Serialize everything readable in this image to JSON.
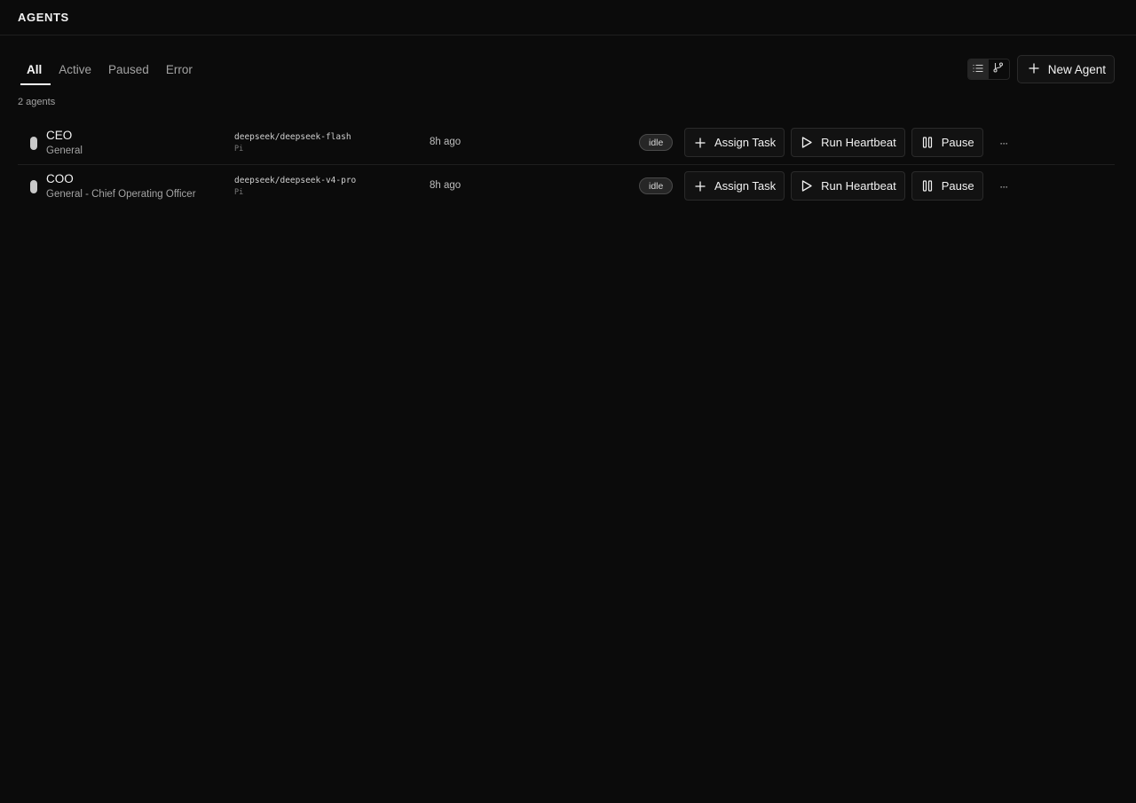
{
  "header": {
    "title": "AGENTS"
  },
  "tabs": [
    {
      "label": "All",
      "active": true
    },
    {
      "label": "Active",
      "active": false
    },
    {
      "label": "Paused",
      "active": false
    },
    {
      "label": "Error",
      "active": false
    }
  ],
  "toolbar": {
    "view_modes": [
      "list-icon",
      "tree-icon"
    ],
    "selected_view": "list",
    "new_agent_label": "New Agent"
  },
  "count_label": "2 agents",
  "agents": [
    {
      "name": "CEO",
      "role": "General",
      "model": "deepseek/deepseek-flash",
      "provider": "Pi",
      "last_active": "8h ago",
      "status": "idle",
      "actions": {
        "assign": "Assign Task",
        "heartbeat": "Run Heartbeat",
        "pause": "Pause",
        "more": "···"
      }
    },
    {
      "name": "COO",
      "role": "General - Chief Operating Officer",
      "model": "deepseek/deepseek-v4-pro",
      "provider": "Pi",
      "last_active": "8h ago",
      "status": "idle",
      "actions": {
        "assign": "Assign Task",
        "heartbeat": "Run Heartbeat",
        "pause": "Pause",
        "more": "···"
      }
    }
  ],
  "colors": {
    "background": "#0b0b0b",
    "border": "#2a2a2a",
    "text": "#f2f2f2",
    "muted": "#a3a3a3"
  }
}
